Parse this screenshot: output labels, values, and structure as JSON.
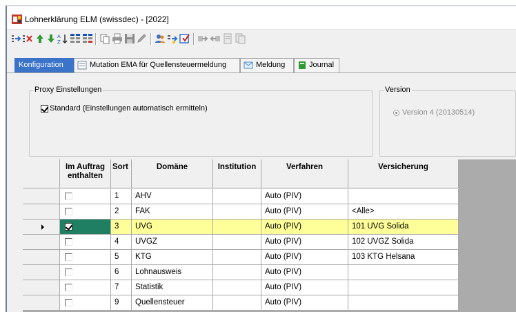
{
  "window": {
    "title": "Lohnerklärung ELM (swissdec) - [2022]"
  },
  "toolbar": {
    "buttons": [
      "insert-row-icon",
      "delete-row-icon",
      "move-up-icon",
      "move-down-icon",
      "sort-icon",
      "filter-icon",
      "filter-remove-icon",
      "copy-icon",
      "print-icon",
      "save-icon",
      "validate-icon",
      "users-icon",
      "send-icon",
      "export-icon",
      "arrow-right-icon",
      "arrow-left-icon",
      "document-icon",
      "document-copy-icon"
    ]
  },
  "tabs": [
    {
      "label": "Konfiguration",
      "icon": "",
      "active": true
    },
    {
      "label": "Mutation EMA für Quellensteuermeldung",
      "icon": "form-icon",
      "active": false
    },
    {
      "label": "Meldung",
      "icon": "message-icon",
      "active": false
    },
    {
      "label": "Journal",
      "icon": "book-icon",
      "active": false
    }
  ],
  "proxy": {
    "group_title": "Proxy Einstellungen",
    "checkbox_label": "Standard (Einstellungen automatisch ermitteln)",
    "checked": true
  },
  "version": {
    "group_title": "Version",
    "option_label": "Version 4 (20130514)"
  },
  "grid": {
    "headers": {
      "included": "Im Auftrag enthalten",
      "sort": "Sort",
      "domain": "Domäne",
      "institution": "Institution",
      "procedure": "Verfahren",
      "insurance": "Versicherung"
    },
    "rows": [
      {
        "checked": false,
        "sort": "1",
        "domain": "AHV",
        "institution": "",
        "procedure": "Auto (PIV)",
        "insurance": ""
      },
      {
        "checked": false,
        "sort": "2",
        "domain": "FAK",
        "institution": "",
        "procedure": "Auto (PIV)",
        "insurance": "<Alle>"
      },
      {
        "checked": true,
        "sort": "3",
        "domain": "UVG",
        "institution": "",
        "procedure": "Auto (PIV)",
        "insurance": "101 UVG Solida",
        "selected": true
      },
      {
        "checked": false,
        "sort": "4",
        "domain": "UVGZ",
        "institution": "",
        "procedure": "Auto (PIV)",
        "insurance": "102 UVGZ Solida"
      },
      {
        "checked": false,
        "sort": "5",
        "domain": "KTG",
        "institution": "",
        "procedure": "Auto (PIV)",
        "insurance": "103 KTG Helsana"
      },
      {
        "checked": false,
        "sort": "6",
        "domain": "Lohnausweis",
        "institution": "",
        "procedure": "Auto (PIV)",
        "insurance": ""
      },
      {
        "checked": false,
        "sort": "7",
        "domain": "Statistik",
        "institution": "",
        "procedure": "Auto (PIV)",
        "insurance": ""
      },
      {
        "checked": false,
        "sort": "9",
        "domain": "Quellensteuer",
        "institution": "",
        "procedure": "Auto (PIV)",
        "insurance": ""
      }
    ]
  },
  "colors": {
    "active_tab": "#3a73c8",
    "selected_row": "#ffff99",
    "active_cell": "#1f7f63"
  }
}
